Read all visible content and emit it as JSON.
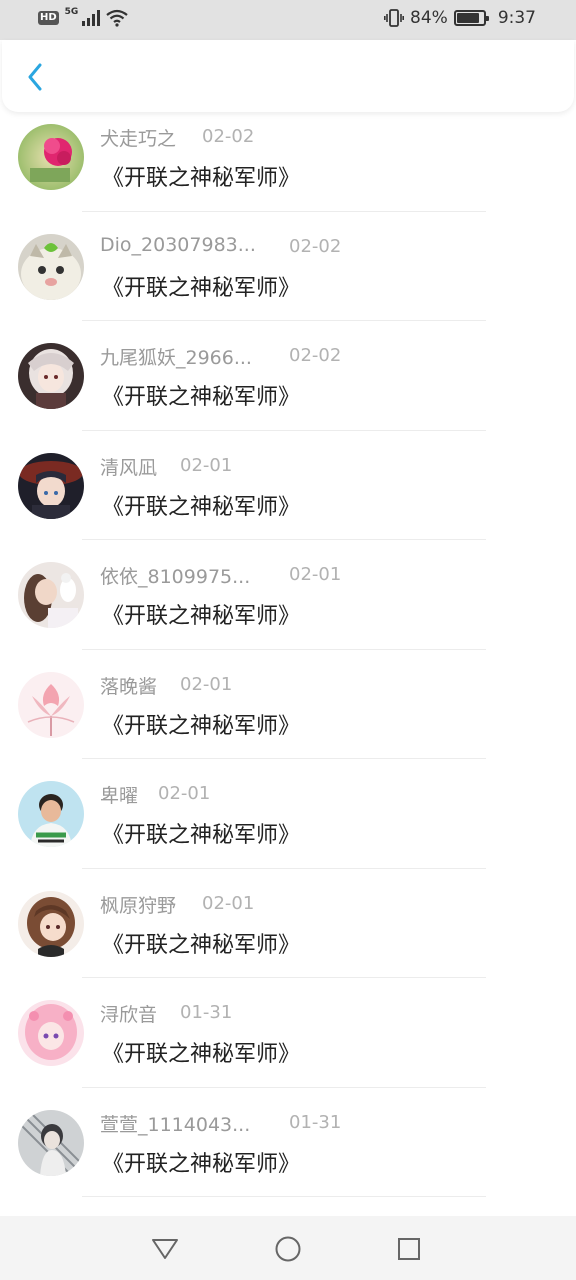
{
  "status_bar": {
    "hd": "HD",
    "network": "5G",
    "battery_percent": "84%",
    "battery_level": 0.84,
    "time": "9:37"
  },
  "header": {
    "back_icon": "chevron-left-icon",
    "accent_color": "#2aa6e0"
  },
  "items": [
    {
      "username": "犬走巧之",
      "date": "02-02",
      "message": "《开联之神秘军师》"
    },
    {
      "username": "Dio_20307983...",
      "date": "02-02",
      "message": "《开联之神秘军师》"
    },
    {
      "username": "九尾狐妖_2966...",
      "date": "02-02",
      "message": "《开联之神秘军师》"
    },
    {
      "username": "清风凪",
      "date": "02-01",
      "message": "《开联之神秘军师》"
    },
    {
      "username": "依依_8109975...",
      "date": "02-01",
      "message": "《开联之神秘军师》"
    },
    {
      "username": "落晚酱",
      "date": "02-01",
      "message": "《开联之神秘军师》"
    },
    {
      "username": "卑曜",
      "date": "02-01",
      "message": "《开联之神秘军师》"
    },
    {
      "username": "枫原狩野",
      "date": "02-01",
      "message": "《开联之神秘军师》"
    },
    {
      "username": "浔欣音",
      "date": "01-31",
      "message": "《开联之神秘军师》"
    },
    {
      "username": "萱萱_1114043...",
      "date": "01-31",
      "message": "《开联之神秘军师》"
    }
  ],
  "nav_bar": {
    "back_icon": "triangle-back-icon",
    "home_icon": "circle-home-icon",
    "recent_icon": "square-recents-icon"
  }
}
